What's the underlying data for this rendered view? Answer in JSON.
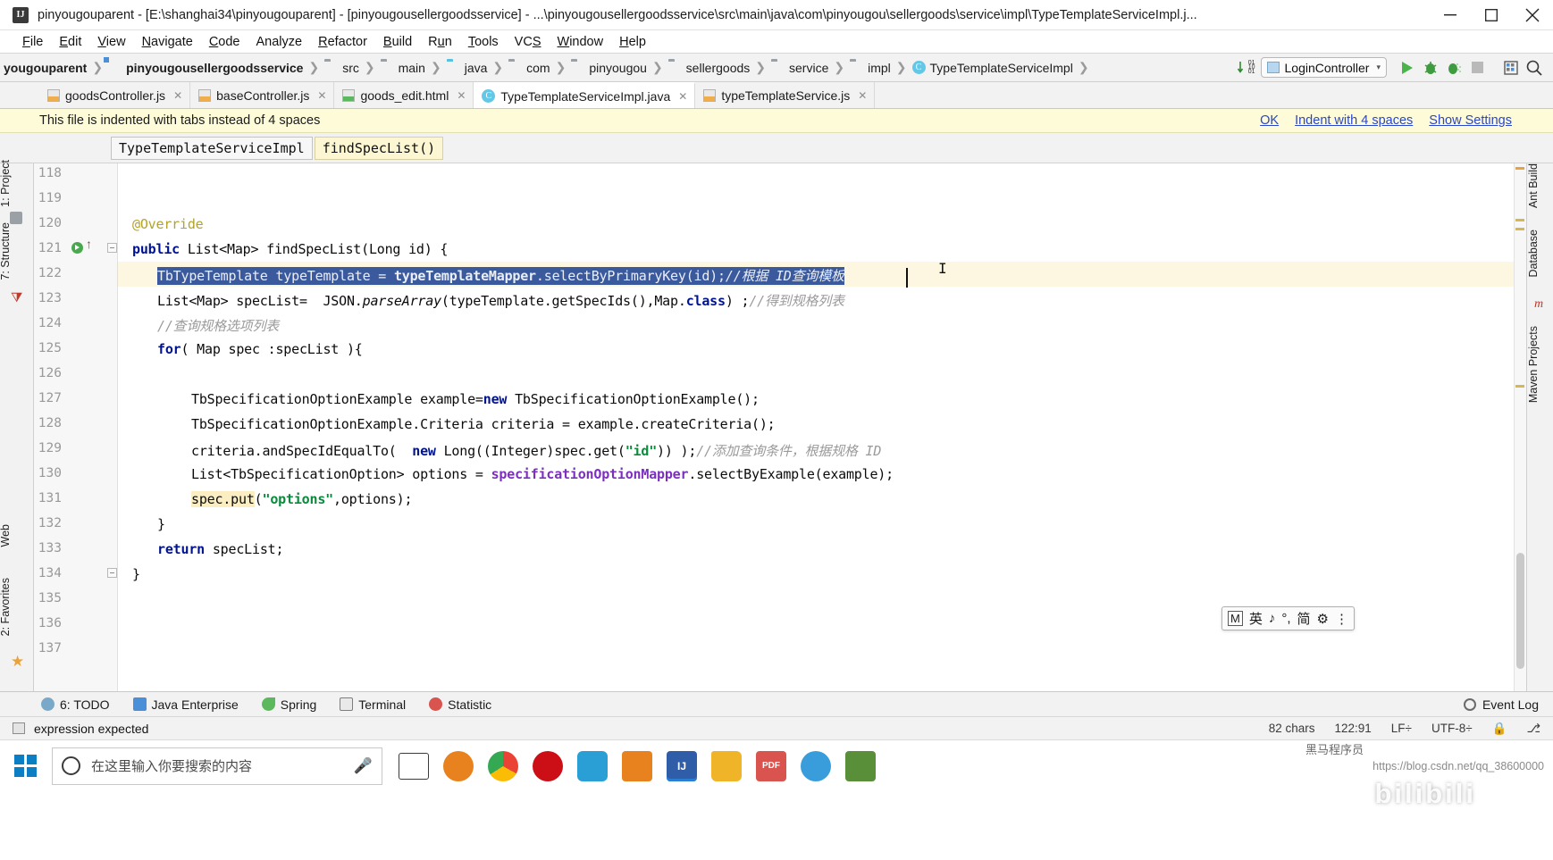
{
  "window": {
    "title": "pinyougouparent - [E:\\shanghai34\\pinyougouparent] - [pinyougousellergoodsservice] - ...\\pinyougousellergoodsservice\\src\\main\\java\\com\\pinyougou\\sellergoods\\service\\impl\\TypeTemplateServiceImpl.j...",
    "app_icon": "intellij-idea-icon",
    "minimize": "–",
    "maximize": "□",
    "close": "✕"
  },
  "menubar": {
    "items": [
      "File",
      "Edit",
      "View",
      "Navigate",
      "Code",
      "Analyze",
      "Refactor",
      "Build",
      "Run",
      "Tools",
      "VCS",
      "Window",
      "Help"
    ]
  },
  "navbar": {
    "crumbs": [
      {
        "label": "yougouparent",
        "icon": "none",
        "bold": true
      },
      {
        "label": "pinyougousellergoodsservice",
        "icon": "module",
        "bold": true
      },
      {
        "label": "src",
        "icon": "folder-grey",
        "bold": false
      },
      {
        "label": "main",
        "icon": "folder-grey",
        "bold": false
      },
      {
        "label": "java",
        "icon": "folder-blue",
        "bold": false
      },
      {
        "label": "com",
        "icon": "folder-grey",
        "bold": false
      },
      {
        "label": "pinyougou",
        "icon": "folder-grey",
        "bold": false
      },
      {
        "label": "sellergoods",
        "icon": "folder-grey",
        "bold": false
      },
      {
        "label": "service",
        "icon": "folder-grey",
        "bold": false
      },
      {
        "label": "impl",
        "icon": "folder-grey",
        "bold": false
      },
      {
        "label": "TypeTemplateServiceImpl",
        "icon": "class",
        "bold": false
      }
    ],
    "run_config": "LoginController",
    "run_config_caret": "▾",
    "sort_icon": "sort-numeric-icon",
    "buttons": [
      "run-button",
      "debug-button",
      "run-coverage-button",
      "stop-button",
      "build-button",
      "search-everywhere-button"
    ]
  },
  "tabs": [
    {
      "label": "goodsController.js",
      "type": "js",
      "active": false,
      "close": "✕"
    },
    {
      "label": "baseController.js",
      "type": "js",
      "active": false,
      "close": "✕"
    },
    {
      "label": "goods_edit.html",
      "type": "html",
      "active": false,
      "close": "✕"
    },
    {
      "label": "TypeTemplateServiceImpl.java",
      "type": "java",
      "active": true,
      "close": "✕"
    },
    {
      "label": "typeTemplateService.js",
      "type": "js",
      "active": false,
      "close": "✕"
    }
  ],
  "banner": {
    "message": "This file is indented with tabs instead of 4 spaces",
    "links": [
      "OK",
      "Indent with 4 spaces",
      "Show Settings"
    ]
  },
  "structure_breadcrumb": {
    "class": "TypeTemplateServiceImpl",
    "method": "findSpecList()"
  },
  "editor": {
    "line_numbers": [
      118,
      119,
      120,
      121,
      122,
      123,
      124,
      125,
      126,
      127,
      128,
      129,
      130,
      131,
      132,
      133,
      134,
      135,
      136,
      137
    ],
    "lines": [
      {
        "no": 118,
        "text": ""
      },
      {
        "no": 119,
        "text": ""
      },
      {
        "no": 120,
        "text": "        @Override"
      },
      {
        "no": 121,
        "text": "        public List<Map> findSpecList(Long id) {"
      },
      {
        "no": 122,
        "text": "            TbTypeTemplate typeTemplate = typeTemplateMapper.selectByPrimaryKey(id);//根据ID查询模板",
        "selected": true
      },
      {
        "no": 123,
        "text": "            List<Map> specList=  JSON.parseArray(typeTemplate.getSpecIds(),Map.class) ;//得到规格列表"
      },
      {
        "no": 124,
        "text": "            //查询规格选项列表"
      },
      {
        "no": 125,
        "text": "            for( Map spec :specList ){"
      },
      {
        "no": 126,
        "text": ""
      },
      {
        "no": 127,
        "text": "                TbSpecificationOptionExample example=new TbSpecificationOptionExample();"
      },
      {
        "no": 128,
        "text": "                TbSpecificationOptionExample.Criteria criteria = example.createCriteria();"
      },
      {
        "no": 129,
        "text": "                criteria.andSpecIdEqualTo( new Long((Integer)spec.get(\"id\")) );//添加查询条件，根据规格ID"
      },
      {
        "no": 130,
        "text": "                List<TbSpecificationOption> options = specificationOptionMapper.selectByExample(example);"
      },
      {
        "no": 131,
        "text": "                spec.put(\"options\",options);"
      },
      {
        "no": 132,
        "text": "            }"
      },
      {
        "no": 133,
        "text": "            return specList;"
      },
      {
        "no": 134,
        "text": "        }"
      },
      {
        "no": 135,
        "text": ""
      },
      {
        "no": 136,
        "text": "}"
      },
      {
        "no": 137,
        "text": ""
      }
    ]
  },
  "left_rails": [
    {
      "label": "1: Project",
      "name": "sidebar-item-project"
    },
    {
      "label": "7: Structure",
      "name": "sidebar-item-structure"
    },
    {
      "label": "Web",
      "name": "sidebar-item-web"
    },
    {
      "label": "2: Favorites",
      "name": "sidebar-item-favorites"
    }
  ],
  "right_rails": [
    {
      "label": "Ant Build",
      "name": "sidebar-item-ant-build"
    },
    {
      "label": "Database",
      "name": "sidebar-item-database"
    },
    {
      "label": "Maven Projects",
      "name": "sidebar-item-maven-projects"
    }
  ],
  "ime": {
    "mode": "M",
    "lang": "英",
    "tone": "♪",
    "punct": "°,",
    "shape": "简",
    "settings": "⚙",
    "handle": "⋮"
  },
  "bottom_toolwindows": [
    {
      "label": "6: TODO",
      "icon": "todo-icon",
      "color": "#7aa8c9"
    },
    {
      "label": "Java Enterprise",
      "icon": "java-enterprise-icon",
      "color": "#4a90d9"
    },
    {
      "label": "Spring",
      "icon": "spring-icon",
      "color": "#5cb85c"
    },
    {
      "label": "Terminal",
      "icon": "terminal-icon",
      "color": "#8d8d8d"
    },
    {
      "label": "Statistic",
      "icon": "statistic-icon",
      "color": "#d9534f"
    }
  ],
  "event_log": "Event Log",
  "statusbar": {
    "message": "expression expected",
    "chars": "82 chars",
    "caret_position": "122:91",
    "line_separator": "LF÷",
    "encoding": "UTF-8÷",
    "lock_icon": "lock-icon",
    "git_icon": "git-branch-icon"
  },
  "taskbar": {
    "search_placeholder": "在这里输入你要搜索的内容",
    "start_icon": "windows-start-icon",
    "cortana_icon": "cortana-circle-icon",
    "mic_icon": "microphone-icon",
    "task_view_icon": "task-view-icon",
    "apps": [
      {
        "name": "fox-browser-icon",
        "color": "#e8821e",
        "label": ""
      },
      {
        "name": "chrome-icon",
        "color": "#4285f4",
        "label": ""
      },
      {
        "name": "opera-icon",
        "color": "#cc0f16",
        "label": ""
      },
      {
        "name": "app-blue-icon",
        "color": "#2a9fd6",
        "label": ""
      },
      {
        "name": "folder-orange-icon",
        "color": "#e8821e",
        "label": ""
      },
      {
        "name": "intellij-icon",
        "color": "#2a7fd4",
        "label": "IJ",
        "active": true
      },
      {
        "name": "explorer-icon",
        "color": "#f0b429",
        "label": ""
      },
      {
        "name": "pdf-icon",
        "color": "#d9534f",
        "label": "PDF"
      },
      {
        "name": "wechat-icon",
        "color": "#3a9ddb",
        "label": ""
      },
      {
        "name": "editor-icon",
        "color": "#5a8f3a",
        "label": ""
      }
    ]
  },
  "watermark": {
    "brand": "bilibili",
    "url": "https://blog.csdn.net/qq_38600000",
    "cn_brand": "黑马程序员"
  },
  "colors": {
    "selection": "#3b5a9e",
    "keyword": "#00138f",
    "string": "#0a8a3b",
    "field": "#7b2fbe",
    "comment": "#9a9a9a",
    "annotation": "#b2a32a",
    "banner_bg": "#fdfbd8",
    "link": "#2a46c9"
  }
}
